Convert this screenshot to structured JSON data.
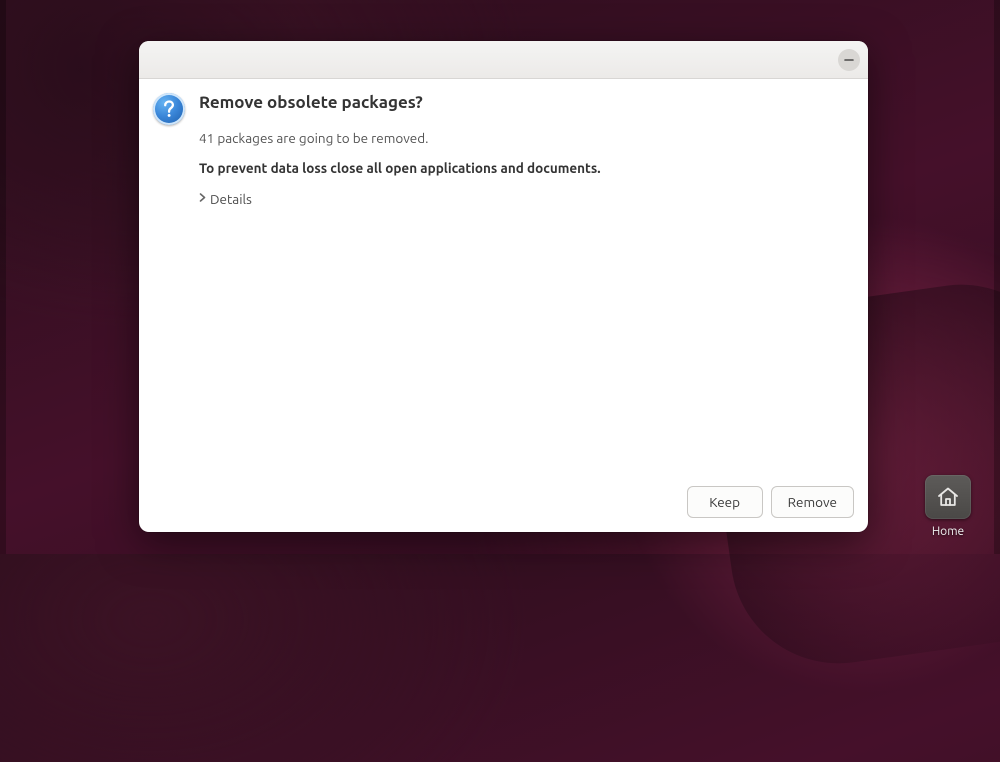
{
  "dialog": {
    "title": "Remove obsolete packages?",
    "message": "41 packages are going to be removed.",
    "warning": "To prevent data loss close all open applications and documents.",
    "details_label": "Details",
    "buttons": {
      "keep": "Keep",
      "remove": "Remove"
    }
  },
  "desktop": {
    "home_label": "Home"
  }
}
